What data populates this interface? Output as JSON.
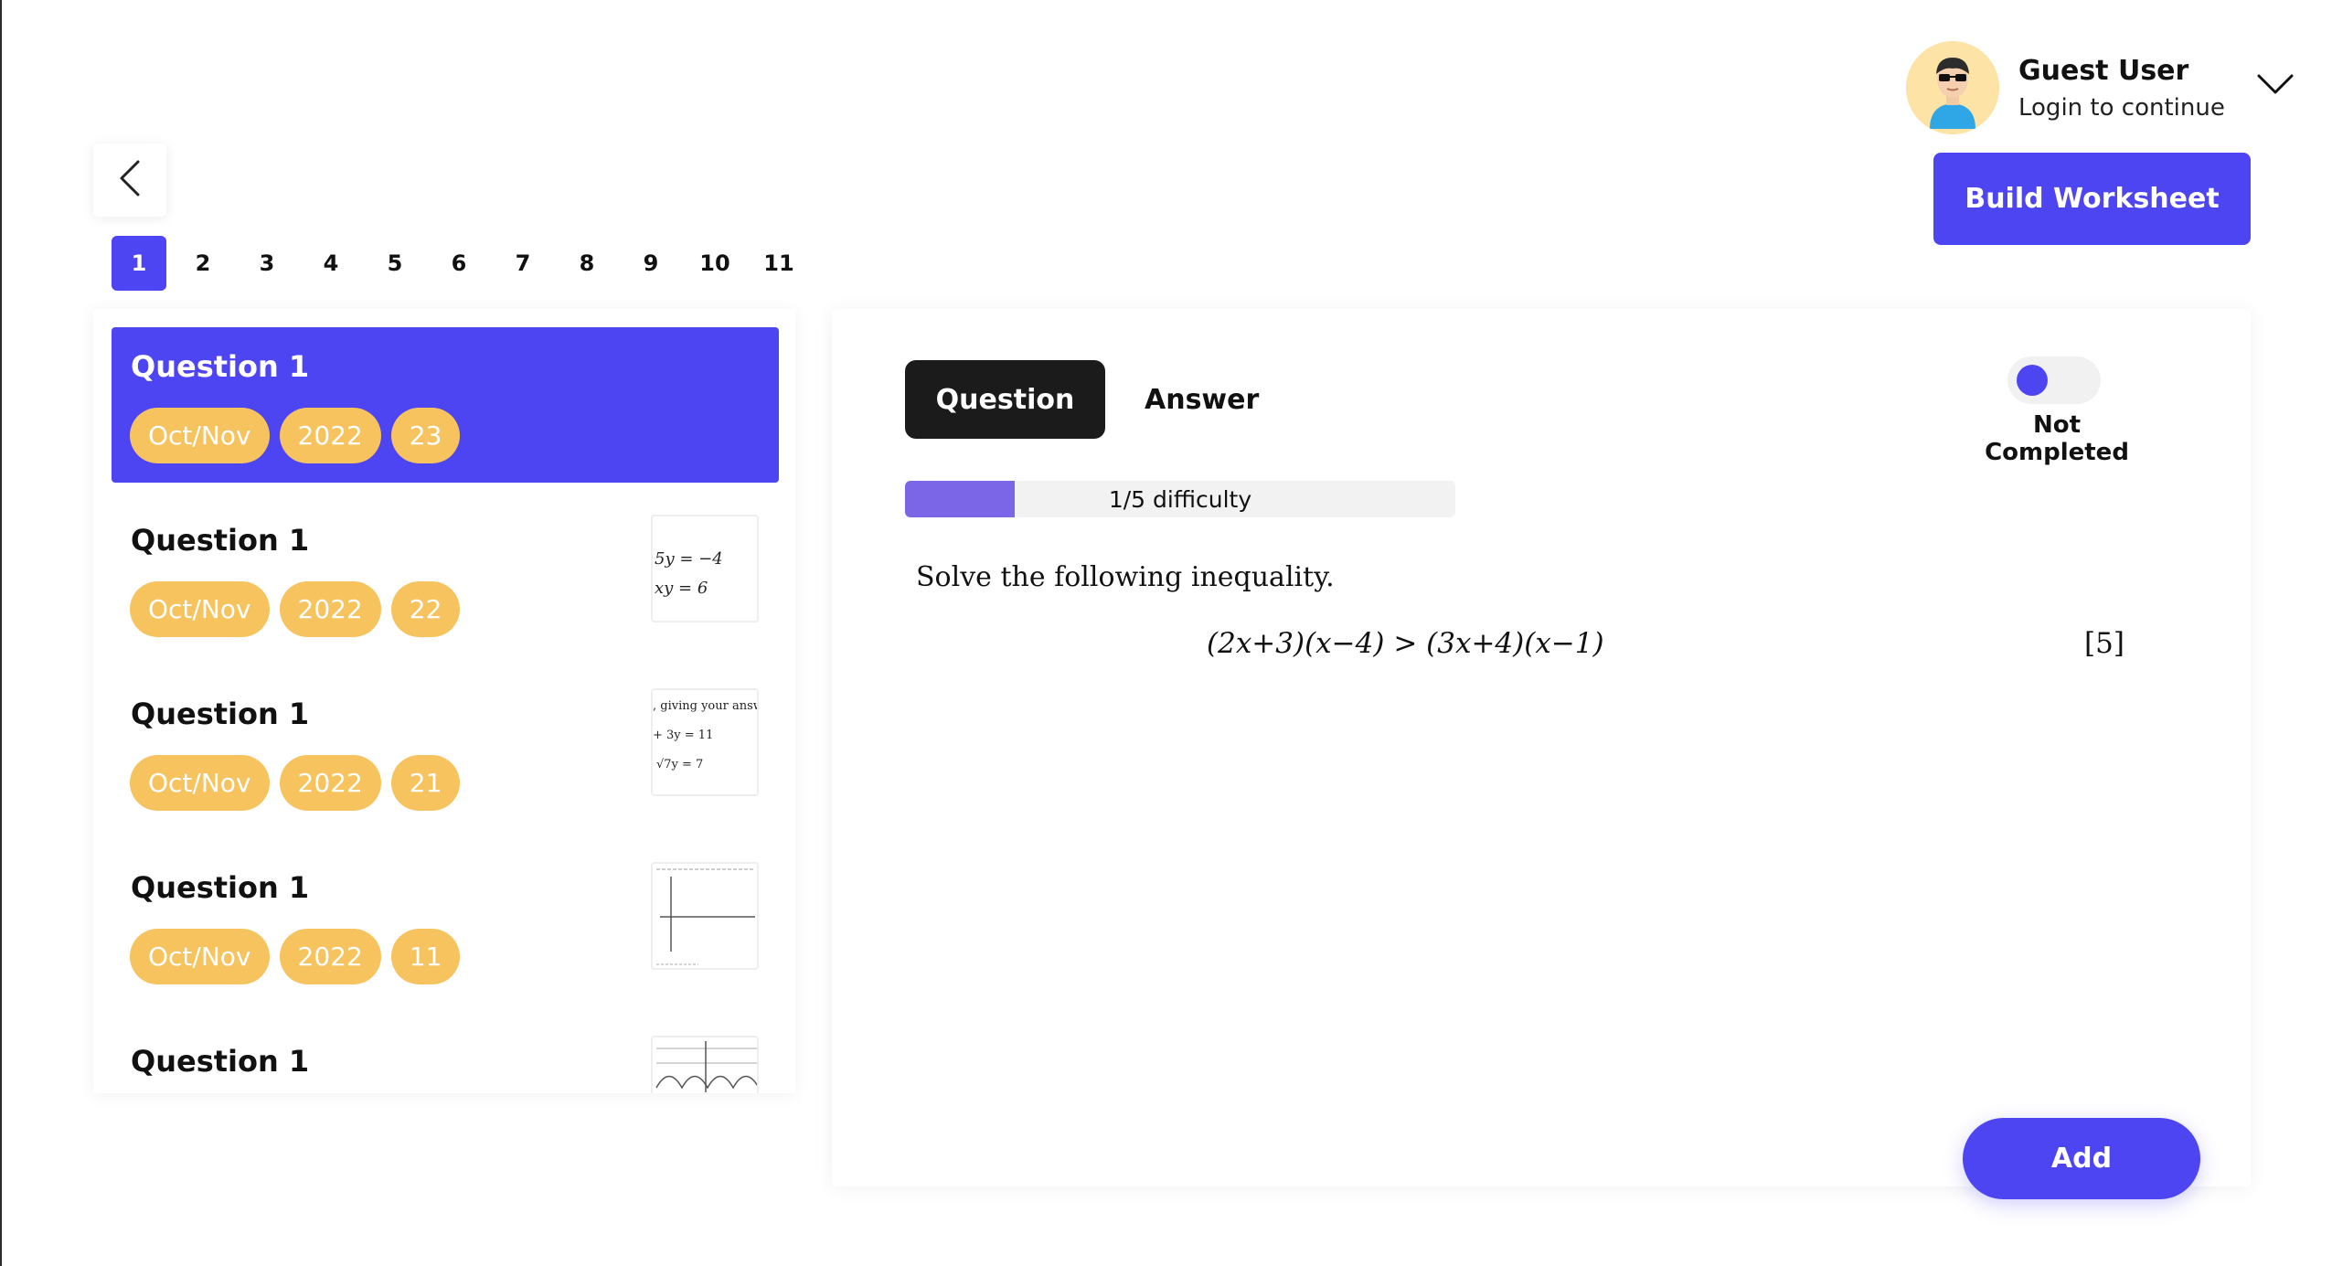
{
  "user": {
    "name": "Guest User",
    "subtitle": "Login to continue",
    "avatar_icon": "guest-avatar-icon",
    "menu_icon": "chevron-down-icon"
  },
  "toolbar": {
    "build_worksheet_label": "Build Worksheet",
    "back_icon": "chevron-left-icon"
  },
  "pager": {
    "pages": [
      "1",
      "2",
      "3",
      "4",
      "5",
      "6",
      "7",
      "8",
      "9",
      "10",
      "11"
    ],
    "active": "1"
  },
  "question_list": [
    {
      "title": "Question 1",
      "session": "Oct/Nov",
      "year": "2022",
      "paper": "23",
      "active": true
    },
    {
      "title": "Question 1",
      "session": "Oct/Nov",
      "year": "2022",
      "paper": "22",
      "thumb_lines": [
        "5y = −4",
        "xy = 6"
      ]
    },
    {
      "title": "Question 1",
      "session": "Oct/Nov",
      "year": "2022",
      "paper": "21",
      "thumb_lines": [
        ", giving your answ",
        "+ 3y = 11",
        "√7y = 7"
      ]
    },
    {
      "title": "Question 1",
      "session": "Oct/Nov",
      "year": "2022",
      "paper": "11"
    },
    {
      "title": "Question 1"
    }
  ],
  "detail": {
    "tabs": {
      "question": "Question",
      "answer": "Answer"
    },
    "status_label": "Not Completed",
    "difficulty_label": "1/5 difficulty",
    "difficulty_level": 0.2,
    "question_text": "Solve the following inequality.",
    "question_expression": "(2x+3)(x−4) > (3x+4)(x−1)",
    "question_marks": "[5]",
    "add_label": "Add"
  },
  "colors": {
    "accent": "#4d44f2",
    "chip": "#f7c35f",
    "difficulty_fill": "#7a66e6",
    "dark_tab": "#1b1b1b"
  }
}
